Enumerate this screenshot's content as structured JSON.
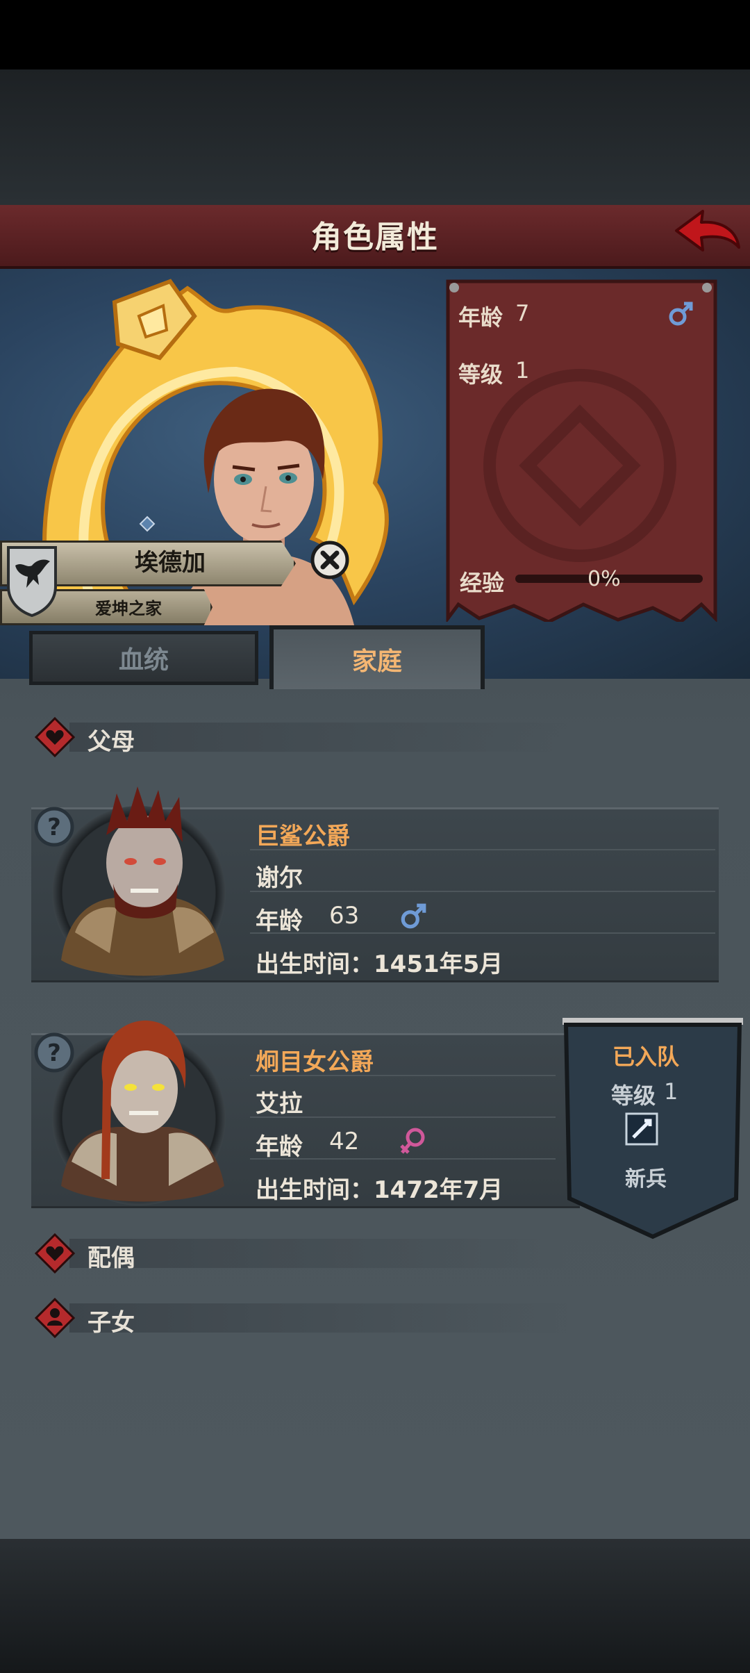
{
  "header": {
    "title": "角色属性"
  },
  "character": {
    "name": "埃德加",
    "house": "爱坤之家",
    "stats": {
      "age_label": "年龄",
      "age_value": "7",
      "level_label": "等级",
      "level_value": "1",
      "exp_label": "经验",
      "exp_value": "0%",
      "exp_fraction": 0
    }
  },
  "tabs": [
    {
      "label": "血统",
      "active": false
    },
    {
      "label": "家庭",
      "active": true
    }
  ],
  "sections": {
    "parents": "父母",
    "spouse": "配偶",
    "children": "子女"
  },
  "parents": [
    {
      "title": "巨鲨公爵",
      "name": "谢尔",
      "age_label": "年龄",
      "age": "63",
      "gender": "male",
      "birth": "出生时间：1451年5月"
    },
    {
      "title": "炯目女公爵",
      "name": "艾拉",
      "age_label": "年龄",
      "age": "42",
      "gender": "female",
      "birth": "出生时间：1472年7月"
    }
  ],
  "team_banner": {
    "status": "已入队",
    "level_label": "等级",
    "level_value": "1",
    "rank": "新兵"
  },
  "colors": {
    "accent_orange": "#f3a858",
    "header_red": "#6b2a2c",
    "male_blue": "#6f9bd6",
    "female_pink": "#d0589a"
  }
}
